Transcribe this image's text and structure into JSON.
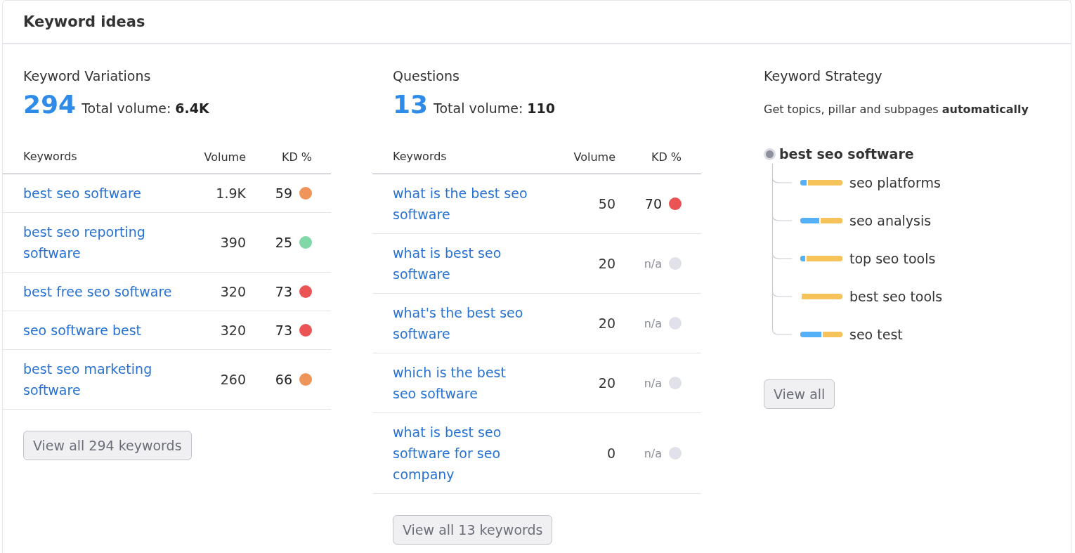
{
  "card": {
    "title": "Keyword ideas"
  },
  "variations": {
    "title": "Keyword Variations",
    "count": "294",
    "volume_label": "Total volume:",
    "volume": "6.4K",
    "columns": [
      "Keywords",
      "Volume",
      "KD %"
    ],
    "rows": [
      {
        "keyword": "best seo software",
        "volume": "1.9K",
        "kd": "59",
        "kind": "scored",
        "color": "#f0955a"
      },
      {
        "keyword": "best seo reporting software",
        "volume": "390",
        "kd": "25",
        "kind": "scored",
        "color": "#7fd8a5"
      },
      {
        "keyword": "best free seo software",
        "volume": "320",
        "kd": "73",
        "kind": "scored",
        "color": "#ea5455"
      },
      {
        "keyword": "seo software best",
        "volume": "320",
        "kd": "73",
        "kind": "scored",
        "color": "#ea5455"
      },
      {
        "keyword": "best seo marketing software",
        "volume": "260",
        "kd": "66",
        "kind": "scored",
        "color": "#f0955a"
      }
    ],
    "button": "View all 294 keywords"
  },
  "questions": {
    "title": "Questions",
    "count": "13",
    "volume_label": "Total volume:",
    "volume": "110",
    "columns": [
      "Keywords",
      "Volume",
      "KD %"
    ],
    "rows": [
      {
        "keyword": "what is the best seo software",
        "volume": "50",
        "kd": "70",
        "kind": "scored",
        "color": "#ea5455"
      },
      {
        "keyword": "what is best seo software",
        "volume": "20",
        "kd": "n/a",
        "kind": "unscored",
        "color": "#e0e1e9"
      },
      {
        "keyword": "what's the best seo software",
        "volume": "20",
        "kd": "n/a",
        "kind": "unscored",
        "color": "#e0e1e9"
      },
      {
        "keyword": "which is the best seo software",
        "volume": "20",
        "kd": "n/a",
        "kind": "unscored",
        "color": "#e0e1e9"
      },
      {
        "keyword": "what is best seo software for seo company",
        "volume": "0",
        "kd": "n/a",
        "kind": "unscored",
        "color": "#e0e1e9"
      }
    ],
    "button": "View all 13 keywords"
  },
  "strategy": {
    "title": "Keyword Strategy",
    "subtitle": "Get topics, pillar and subpages **automatically**",
    "root": "best seo software",
    "children": [
      {
        "label": "seo platforms",
        "level": 0.15
      },
      {
        "label": "seo analysis",
        "level": 0.45
      },
      {
        "label": "top seo tools",
        "level": 0.12
      },
      {
        "label": "best seo tools",
        "level": 0
      },
      {
        "label": "seo test",
        "level": 0.5
      }
    ],
    "button": "View all"
  }
}
